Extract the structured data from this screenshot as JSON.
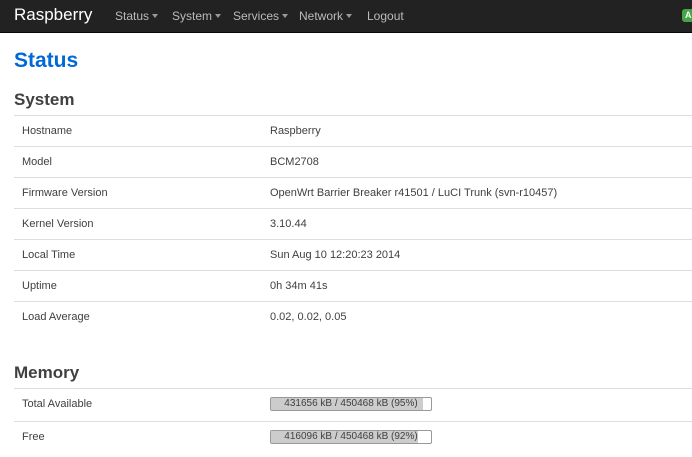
{
  "nav": {
    "brand": "Raspberry",
    "items": [
      {
        "label": "Status",
        "dropdown": true
      },
      {
        "label": "System",
        "dropdown": true
      },
      {
        "label": "Services",
        "dropdown": true
      },
      {
        "label": "Network",
        "dropdown": true
      },
      {
        "label": "Logout",
        "dropdown": false
      }
    ],
    "indicator": "A"
  },
  "page_title": "Status",
  "system": {
    "title": "System",
    "rows": [
      {
        "label": "Hostname",
        "value": "Raspberry"
      },
      {
        "label": "Model",
        "value": "BCM2708"
      },
      {
        "label": "Firmware Version",
        "value": "OpenWrt Barrier Breaker r41501 / LuCI Trunk (svn-r10457)"
      },
      {
        "label": "Kernel Version",
        "value": "3.10.44"
      },
      {
        "label": "Local Time",
        "value": "Sun Aug 10 12:20:23 2014"
      },
      {
        "label": "Uptime",
        "value": "0h 34m 41s"
      },
      {
        "label": "Load Average",
        "value": "0.02, 0.02, 0.05"
      }
    ]
  },
  "memory": {
    "title": "Memory",
    "rows": [
      {
        "label": "Total Available",
        "bar_text": "431656 kB / 450468 kB (95%)",
        "percent": 95
      },
      {
        "label": "Free",
        "bar_text": "416096 kB / 450468 kB (92%)",
        "percent": 92
      }
    ]
  },
  "colors": {
    "navbar": "#222222",
    "title": "#0069d6",
    "indicator": "#46a546"
  }
}
